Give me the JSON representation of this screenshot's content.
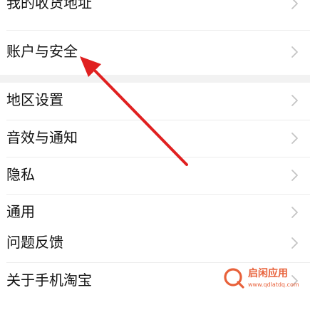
{
  "settings": {
    "items": [
      {
        "label": "我的收货地址"
      },
      {
        "label": "账户与安全"
      },
      {
        "label": "地区设置"
      },
      {
        "label": "音效与通知"
      },
      {
        "label": "隐私"
      },
      {
        "label": "通用"
      },
      {
        "label": "问题反馈"
      },
      {
        "label": "关于手机淘宝"
      }
    ]
  },
  "colors": {
    "arrow": "#e02020",
    "background": "#f2f2f2",
    "row": "#ffffff",
    "chevron": "#c4c4c4",
    "watermark": "#e8613a"
  },
  "icons": {
    "row_chevron": "chevron-right-icon",
    "annotation": "red-arrow-annotation",
    "watermark_logo": "q-logo-icon"
  }
}
